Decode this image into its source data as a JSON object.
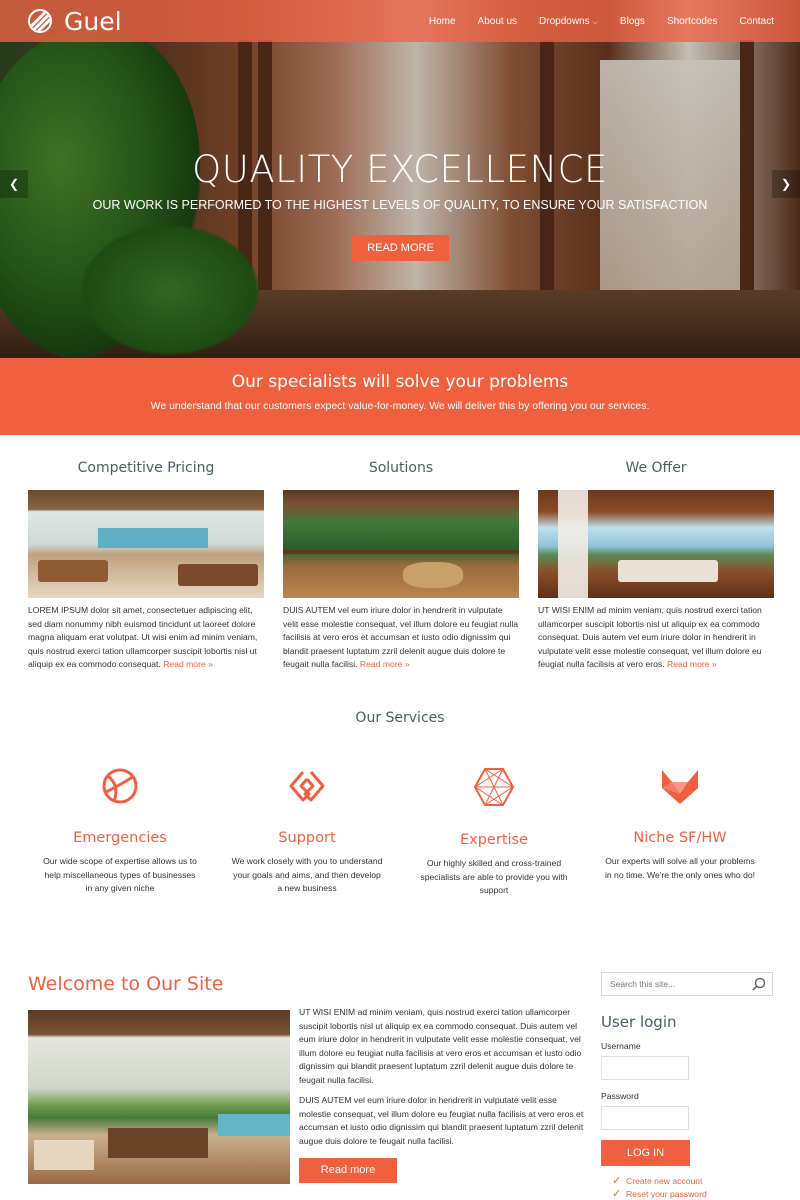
{
  "brand": {
    "name": "Guel",
    "accent": "#f0603f"
  },
  "nav": {
    "items": [
      "Home",
      "About us",
      "Dropdowns",
      "Blogs",
      "Shortcodes",
      "Contact"
    ]
  },
  "hero": {
    "title": "QUALITY EXCELLENCE",
    "subtitle": "OUR WORK IS PERFORMED TO THE HIGHEST LEVELS OF QUALITY, TO ENSURE YOUR SATISFACTION",
    "button": "READ MORE",
    "prev_icon": "chevron-left-icon",
    "next_icon": "chevron-right-icon"
  },
  "banner": {
    "title": "Our specialists will solve your problems",
    "text": "We understand that our customers expect value-for-money. We will deliver this by offering you our services."
  },
  "features": [
    {
      "title": "Competitive Pricing",
      "text": "LOREM IPSUM dolor sit amet, consectetuer adipiscing elit, sed diam nonummy nibh euismod tincidunt ut laoreet dolore magna aliquam erat volutpat. Ut wisi enim ad minim veniam, quis nostrud exerci tation ullamcorper suscipit lobortis nisl ut aliquip ex ea commodo consequat.",
      "link": "Read more »"
    },
    {
      "title": "Solutions",
      "text": "DUIS AUTEM vel eum iriure dolor in hendrerit in vulputate velit esse molestie consequat, vel illum dolore eu feugiat nulla facilisis at vero eros et accumsan et iusto odio dignissim qui blandit praesent luptatum zzril delenit augue duis dolore te feugait nulla facilisi.",
      "link": "Read more »"
    },
    {
      "title": "We Offer",
      "text": "UT WISI ENIM ad minim veniam, quis nostrud exerci tation ullamcorper suscipit lobortis nisl ut aliquip ex ea commodo consequat. Duis autem vel eum iriure dolor in hendrerit in vulputate velit esse molestie consequat, vel illum dolore eu feugiat nulla facilisis at vero eros.",
      "link": "Read more »"
    }
  ],
  "services": {
    "title": "Our Services",
    "items": [
      {
        "icon": "basketball-icon",
        "title": "Emergencies",
        "text": "Our wide scope of expertise allows us to help miscellaneous types of businesses in any given niche"
      },
      {
        "icon": "chain-link-icon",
        "title": "Support",
        "text": "We work closely with you to understand your goals and aims, and then develop a new business"
      },
      {
        "icon": "hexagon-icon",
        "title": "Expertise",
        "text": "Our highly skilled and cross-trained specialists are able to provide you with support"
      },
      {
        "icon": "fox-icon",
        "title": "Niche SF/HW",
        "text": "Our experts will solve all your problems in no time. We're the only ones who do!"
      }
    ]
  },
  "welcome": {
    "title": "Welcome to Our Site",
    "p1": "UT WISI ENIM ad minim veniam, quis nostrud exerci tation ullamcorper suscipit lobortis nisl ut aliquip ex ea commodo consequat. Duis autem vel eum iriure dolor in hendrerit in vulputate velit esse molestie consequat, vel illum dolore eu feugiat nulla facilisis at vero eros et accumsan et iusto odio dignissim qui blandit praesent luptatum zzril delenit augue duis dolore te feugait nulla facilisi.",
    "p2": "DUIS AUTEM vel eum iriure dolor in hendrerit in vulputate velit esse molestie consequat, vel illum dolore eu feugiat nulla facilisis at vero eros et accumsan et iusto odio dignissim qui blandit praesent luptatum zzril delenit augue duis dolore te feugait nulla facilisi.",
    "button": "Read more"
  },
  "sidebar": {
    "search_placeholder": "Search this site...",
    "login_title": "User login",
    "username_label": "Username",
    "password_label": "Password",
    "login_button": "LOG IN",
    "links": [
      "Create new account",
      "Reset your password"
    ]
  }
}
